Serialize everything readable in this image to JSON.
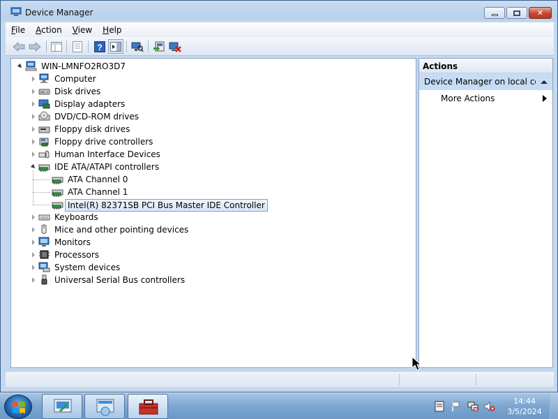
{
  "window": {
    "title": "Device Manager"
  },
  "menu": [
    {
      "key": "F",
      "rest": "ile"
    },
    {
      "key": "A",
      "rest": "ction"
    },
    {
      "key": "V",
      "rest": "iew"
    },
    {
      "key": "H",
      "rest": "elp"
    }
  ],
  "tree": {
    "root": "WIN-LMNFO2RO3D7",
    "nodes": [
      {
        "label": "Computer",
        "icon": "computer-icon",
        "level": 1,
        "expander": "collapsed"
      },
      {
        "label": "Disk drives",
        "icon": "disk-drive-icon",
        "level": 1,
        "expander": "collapsed"
      },
      {
        "label": "Display adapters",
        "icon": "display-adapter-icon",
        "level": 1,
        "expander": "collapsed"
      },
      {
        "label": "DVD/CD-ROM drives",
        "icon": "dvd-drive-icon",
        "level": 1,
        "expander": "collapsed"
      },
      {
        "label": "Floppy disk drives",
        "icon": "floppy-disk-icon",
        "level": 1,
        "expander": "collapsed"
      },
      {
        "label": "Floppy drive controllers",
        "icon": "floppy-controller-icon",
        "level": 1,
        "expander": "collapsed"
      },
      {
        "label": "Human Interface Devices",
        "icon": "hid-icon",
        "level": 1,
        "expander": "collapsed"
      },
      {
        "label": "IDE ATA/ATAPI controllers",
        "icon": "ide-controller-icon",
        "level": 1,
        "expander": "expanded"
      },
      {
        "label": "ATA Channel 0",
        "icon": "ide-controller-icon",
        "level": 2,
        "expander": "none"
      },
      {
        "label": "ATA Channel 1",
        "icon": "ide-controller-icon",
        "level": 2,
        "expander": "none"
      },
      {
        "label": "Intel(R) 82371SB PCI Bus Master IDE Controller",
        "icon": "ide-controller-icon",
        "level": 2,
        "expander": "none",
        "selected": true
      },
      {
        "label": "Keyboards",
        "icon": "keyboard-icon",
        "level": 1,
        "expander": "collapsed"
      },
      {
        "label": "Mice and other pointing devices",
        "icon": "mouse-icon",
        "level": 1,
        "expander": "collapsed"
      },
      {
        "label": "Monitors",
        "icon": "monitor-icon",
        "level": 1,
        "expander": "collapsed"
      },
      {
        "label": "Processors",
        "icon": "processor-icon",
        "level": 1,
        "expander": "collapsed"
      },
      {
        "label": "System devices",
        "icon": "system-devices-icon",
        "level": 1,
        "expander": "collapsed"
      },
      {
        "label": "Universal Serial Bus controllers",
        "icon": "usb-icon",
        "level": 1,
        "expander": "collapsed"
      }
    ]
  },
  "actions": {
    "header": "Actions",
    "section": "Device Manager on local co...",
    "more": "More Actions"
  },
  "taskbar": {
    "time": "14:44",
    "date": "3/5/2024"
  },
  "colors": {
    "selection_bg": "#d9e7f8",
    "actions_section_bg": "#c7dcf4",
    "taskbar": "#7da6d1"
  }
}
